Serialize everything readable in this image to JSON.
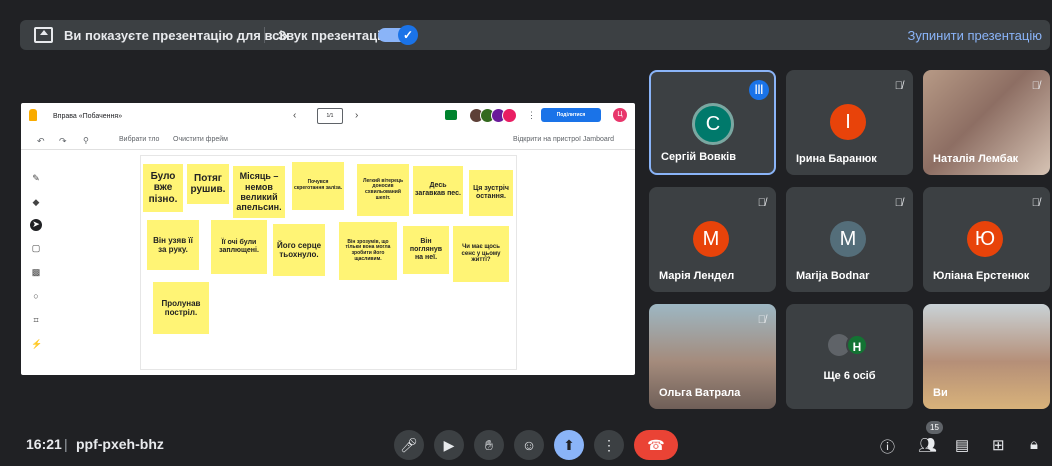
{
  "top_bar": {
    "presenting_text": "Ви показуєте презентацію для всіх",
    "audio_label": "Звук презентації",
    "audio_toggle_checked": true,
    "stop_button": "Зупинити презентацію",
    "accent_color": "#8ab4f8"
  },
  "jamboard": {
    "title": "Вправа «Побачення»",
    "frame_label": "1/1",
    "share_button": "Поділитися",
    "user_initial": "Ц",
    "toolbar": {
      "set_background": "Вибрати тло",
      "clear_frame": "Очистити фрейм",
      "open_on_device": "Відкрити на пристрої Jamboard"
    },
    "notes": [
      "Було вже пізно.",
      "Потяг рушив.",
      "Місяць – немов великий апельсин.",
      "Почувся скреготання заліза.",
      "Легкий вітерець доносив схвильований шепіт.",
      "Десь загавкав пес.",
      "Ця зустріч остання.",
      "Він узяв її за руку.",
      "Її очі були заплющені.",
      "Його серце тьохнуло.",
      "Він зрозумів, що тільки вона могла зробити його щасливим.",
      "Він поглянув на неї.",
      "Чи має щось сенс у цьому житті?",
      "Пролунав постріл."
    ]
  },
  "participants": [
    {
      "name": "Сергій Вовків",
      "initial": "C",
      "color": "#00796b",
      "speaking": true
    },
    {
      "name": "Ірина Баранюк",
      "initial": "І",
      "color": "#e8430a",
      "muted": true
    },
    {
      "name": "Наталія Лембак",
      "photo": true,
      "muted": true
    },
    {
      "name": "Марія Лендел",
      "initial": "М",
      "color": "#e8430a",
      "muted": true
    },
    {
      "name": "Marija Bodnar",
      "initial": "M",
      "color": "#546e7a",
      "muted": true
    },
    {
      "name": "Юліана Ерстенюк",
      "initial": "Ю",
      "color": "#e8430a",
      "muted": true
    },
    {
      "name": "Ольга Ватрала",
      "photo": true,
      "muted": true
    },
    {
      "more_label": "Ще 6 осіб",
      "initial": "H"
    },
    {
      "name": "Ви",
      "photo": true
    }
  ],
  "bottom_bar": {
    "time": "16:21",
    "separator": "|",
    "meeting_code": "ppf-pxeh-bhz",
    "people_count": "15"
  }
}
